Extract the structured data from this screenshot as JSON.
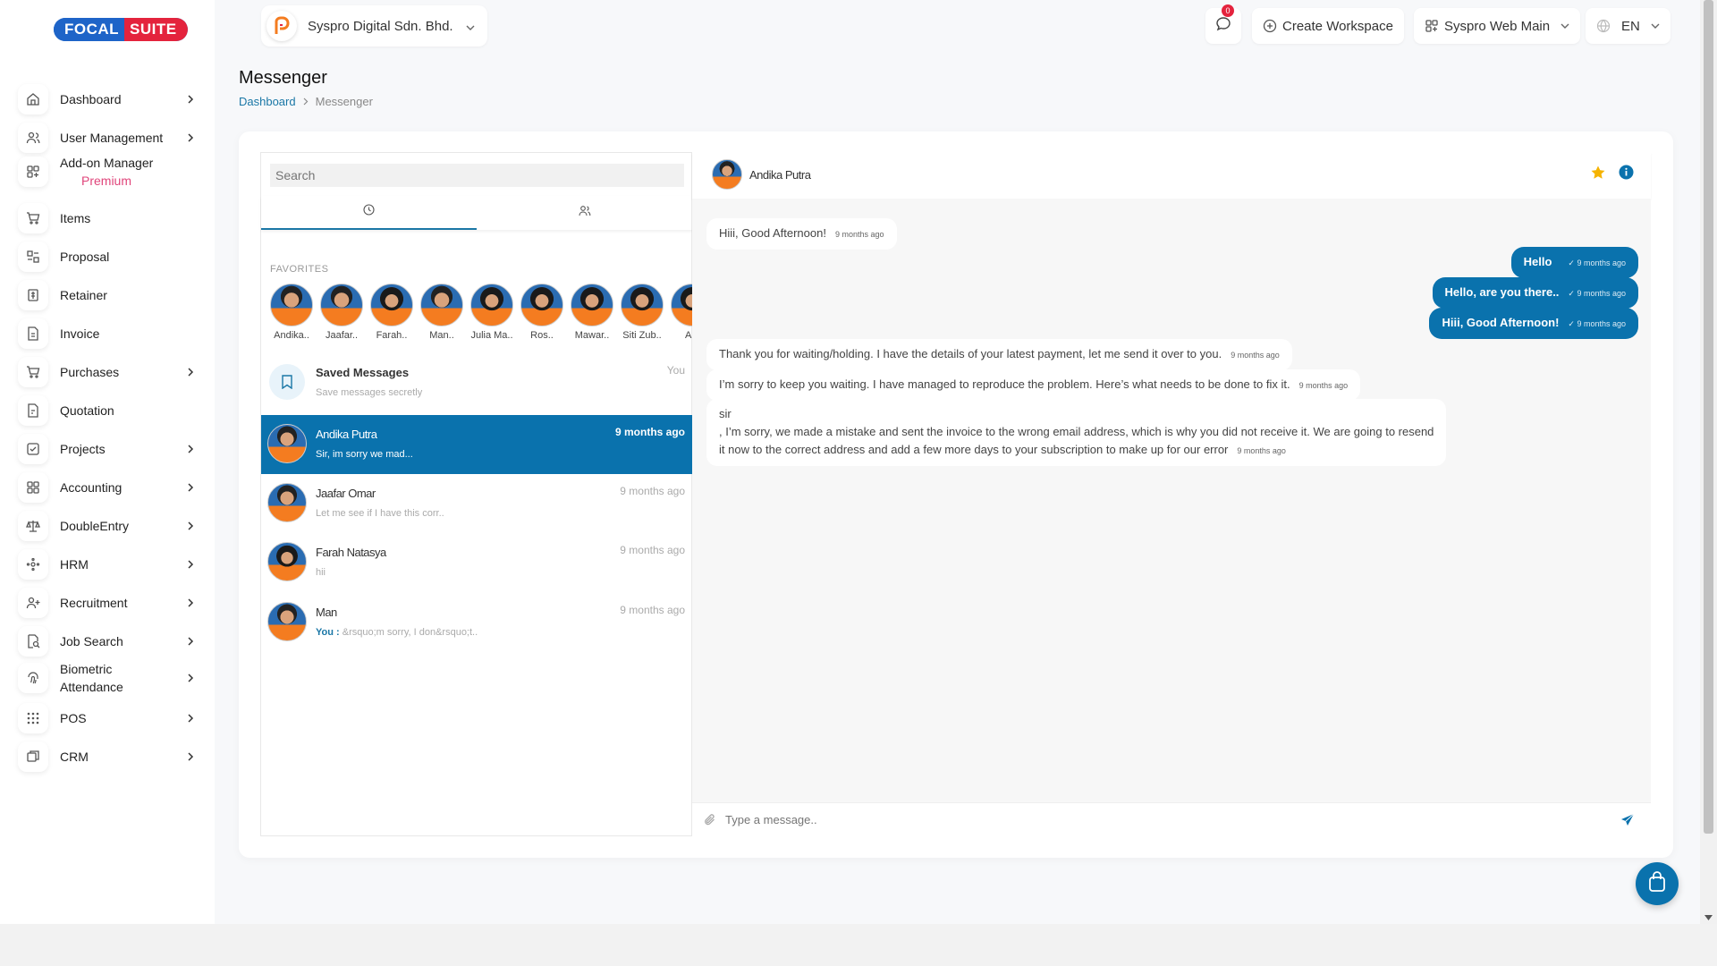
{
  "brand": {
    "part1": "FOCAL",
    "part2": "SUITE"
  },
  "sidebar": {
    "items": [
      {
        "label": "Dashboard",
        "icon": "home-icon",
        "chevron": true
      },
      {
        "label": "User Management",
        "icon": "users-icon",
        "chevron": true
      },
      {
        "label": "Add-on Manager",
        "sub": "Premium",
        "icon": "addon-icon",
        "chevron": false
      },
      {
        "label": "Items",
        "icon": "cart-icon",
        "chevron": false
      },
      {
        "label": "Proposal",
        "icon": "proposal-icon",
        "chevron": false
      },
      {
        "label": "Retainer",
        "icon": "retainer-icon",
        "chevron": false
      },
      {
        "label": "Invoice",
        "icon": "invoice-icon",
        "chevron": false
      },
      {
        "label": "Purchases",
        "icon": "purchases-icon",
        "chevron": true
      },
      {
        "label": "Quotation",
        "icon": "quotation-icon",
        "chevron": false
      },
      {
        "label": "Projects",
        "icon": "projects-icon",
        "chevron": true
      },
      {
        "label": "Accounting",
        "icon": "accounting-icon",
        "chevron": true
      },
      {
        "label": "DoubleEntry",
        "icon": "scale-icon",
        "chevron": true
      },
      {
        "label": "HRM",
        "icon": "hrm-icon",
        "chevron": true
      },
      {
        "label": "Recruitment",
        "icon": "user-plus-icon",
        "chevron": true
      },
      {
        "label": "Job Search",
        "icon": "job-search-icon",
        "chevron": true
      },
      {
        "label": "Biometric",
        "label2": "Attendance",
        "icon": "fingerprint-icon",
        "chevron": true
      },
      {
        "label": "POS",
        "icon": "grid-icon",
        "chevron": true
      },
      {
        "label": "CRM",
        "icon": "crm-icon",
        "chevron": true
      }
    ]
  },
  "header": {
    "company": "Syspro Digital Sdn. Bhd.",
    "notification_count": "0",
    "create_workspace": "Create Workspace",
    "workspace": "Syspro Web Main",
    "language": "EN"
  },
  "page": {
    "title": "Messenger",
    "breadcrumb_home": "Dashboard",
    "breadcrumb_current": "Messenger"
  },
  "messenger": {
    "search_placeholder": "Search",
    "favorites_title": "FAVORITES",
    "favorites": [
      "Andika..",
      "Jaafar..",
      "Farah..",
      "Man..",
      "Julia Ma..",
      "Ros..",
      "Mawar..",
      "Siti Zub..",
      "Ain"
    ],
    "saved": {
      "title": "Saved Messages",
      "subtitle": "Save messages secretly",
      "tag": "You"
    },
    "contacts": [
      {
        "name": "Andika Putra",
        "preview": "Sir, im sorry we mad...",
        "time": "9 months ago",
        "you": ""
      },
      {
        "name": "Jaafar Omar",
        "preview": "Let me see if I have this corr..",
        "time": "9 months ago",
        "you": ""
      },
      {
        "name": "Farah Natasya",
        "preview": "hii",
        "time": "9 months ago",
        "you": ""
      },
      {
        "name": "Man",
        "preview": "&rsquo;m sorry, I don&rsquo;t..",
        "time": "9 months ago",
        "you": "You :"
      }
    ],
    "active_chat": {
      "name": "Andika Putra",
      "messages": [
        {
          "dir": "in",
          "text": "Hiii, Good Afternoon!",
          "time": "9 months ago"
        },
        {
          "dir": "out",
          "text": "Hello",
          "time": "✓ 9 months ago"
        },
        {
          "dir": "out",
          "text": "Hello, are you there..",
          "time": "✓ 9 months ago"
        },
        {
          "dir": "out",
          "text": "Hiii, Good Afternoon!",
          "time": "✓ 9 months ago"
        },
        {
          "dir": "in",
          "text": "Thank you for waiting/holding. I have the details of your latest payment, let me send it over to you.",
          "time": "9 months ago"
        },
        {
          "dir": "in",
          "text": "I’m sorry to keep you waiting. I have managed to reproduce the problem. Here’s what needs to be done to fix it.",
          "time": "9 months ago"
        },
        {
          "dir": "in",
          "line1": "sir",
          "line2": ", I’m sorry, we made a mistake and sent the invoice to the wrong email address, which is why you did not receive it. We are going to resend",
          "line3": "it now to the correct address and add a few more days to your subscription to make up for our error",
          "time": "9 months ago"
        }
      ],
      "input_placeholder": "Type a message.."
    }
  },
  "colors": {
    "primary": "#0a72ad",
    "brand_blue": "#1e64c8",
    "brand_red": "#e4233d",
    "premium": "#e0457b"
  }
}
